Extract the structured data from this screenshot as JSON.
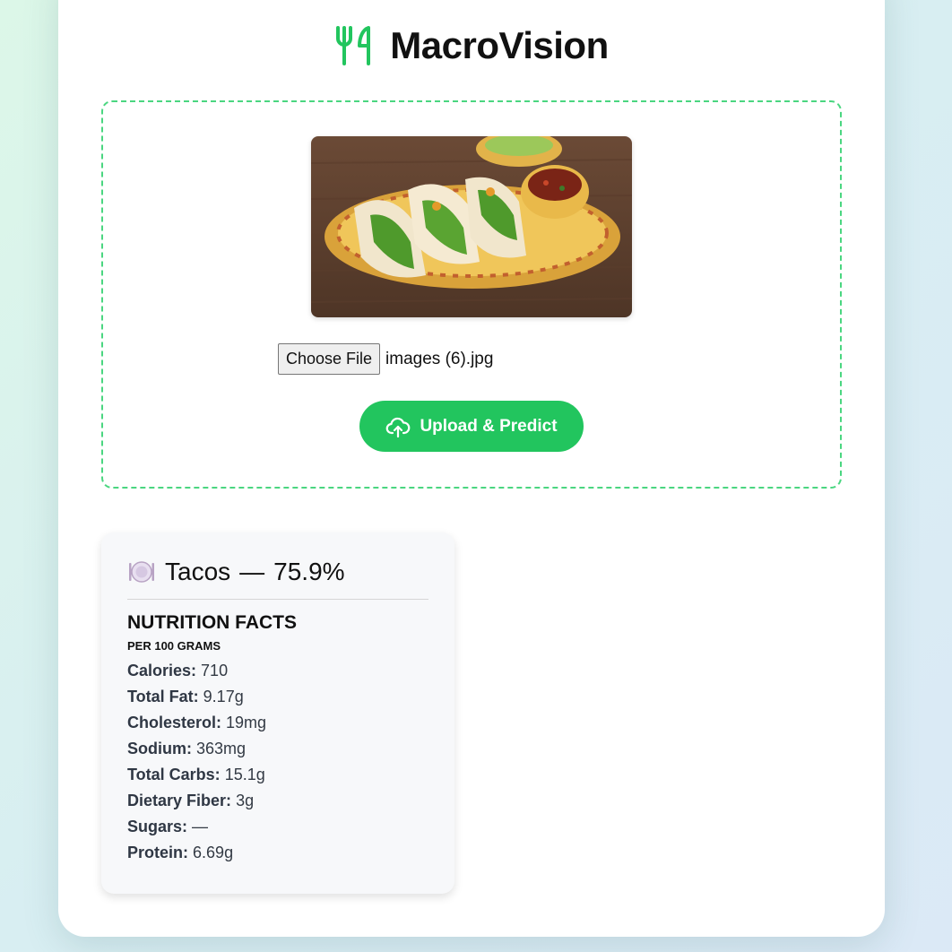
{
  "app": {
    "title": "MacroVision",
    "logo_icon": "fork-knife-icon",
    "accent": "#22c55e"
  },
  "upload": {
    "choose_label": "Choose File",
    "file_name": "images (6).jpg",
    "button_label": "Upload & Predict",
    "button_icon": "cloud-upload-icon"
  },
  "result": {
    "icon": "plate-icon",
    "food": "Tacos",
    "separator": "—",
    "confidence": "75.9%",
    "heading": "NUTRITION FACTS",
    "subheading": "PER 100 GRAMS",
    "facts": [
      {
        "label": "Calories:",
        "value": "710"
      },
      {
        "label": "Total Fat:",
        "value": "9.17g"
      },
      {
        "label": "Cholesterol:",
        "value": "19mg"
      },
      {
        "label": "Sodium:",
        "value": "363mg"
      },
      {
        "label": "Total Carbs:",
        "value": "15.1g"
      },
      {
        "label": "Dietary Fiber:",
        "value": "3g"
      },
      {
        "label": "Sugars:",
        "value": "—"
      },
      {
        "label": "Protein:",
        "value": "6.69g"
      }
    ]
  }
}
